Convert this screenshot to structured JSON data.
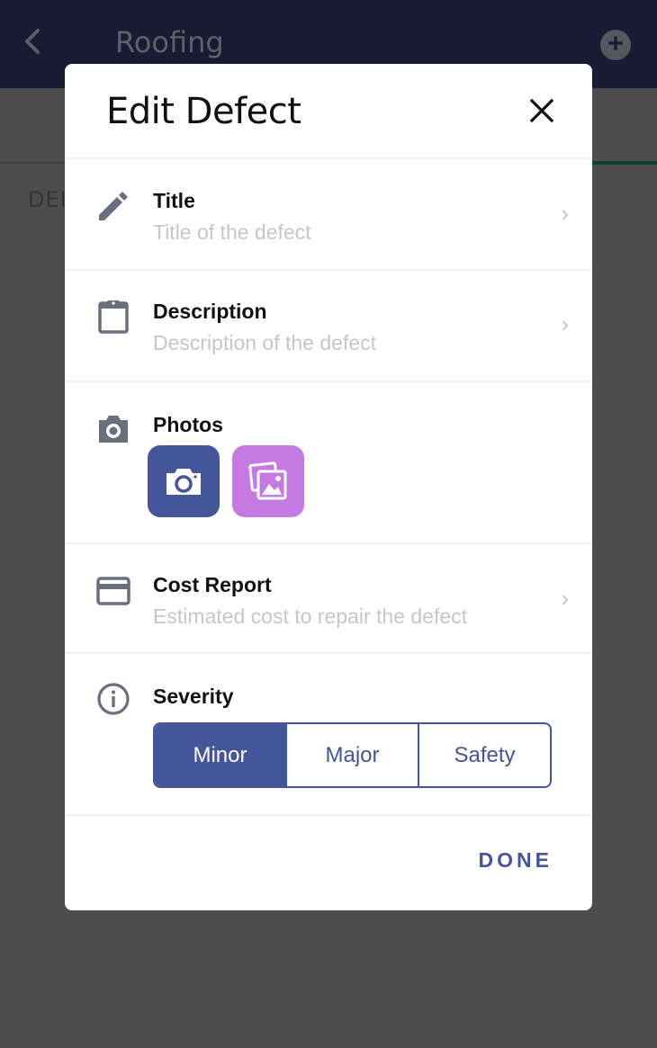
{
  "background": {
    "header": {
      "title": "Roofing",
      "back_icon": "chevron-left-icon",
      "add_icon": "plus-circle-icon"
    },
    "section_label": "DEI"
  },
  "modal": {
    "title": "Edit Defect",
    "close_icon": "close-icon",
    "rows": {
      "title": {
        "icon": "pencil-icon",
        "label": "Title",
        "placeholder": "Title of the defect",
        "chevron": "›"
      },
      "description": {
        "icon": "clipboard-icon",
        "label": "Description",
        "placeholder": "Description of the defect",
        "chevron": "›"
      },
      "photos": {
        "icon": "camera-icon",
        "label": "Photos",
        "buttons": [
          "take-photo",
          "choose-from-gallery"
        ]
      },
      "cost": {
        "icon": "credit-card-icon",
        "label": "Cost Report",
        "placeholder": "Estimated cost to repair the defect",
        "chevron": "›"
      },
      "severity": {
        "icon": "info-icon",
        "label": "Severity",
        "options": [
          "Minor",
          "Major",
          "Safety"
        ],
        "selected": "Minor"
      }
    },
    "done_label": "DONE"
  },
  "colors": {
    "primary": "#45559a",
    "gallery": "#c47ae0",
    "header_bg": "#171b33",
    "overlay": "#4d4d4d",
    "icon_gray": "#6b6f7d",
    "placeholder": "#c6c6cc"
  }
}
